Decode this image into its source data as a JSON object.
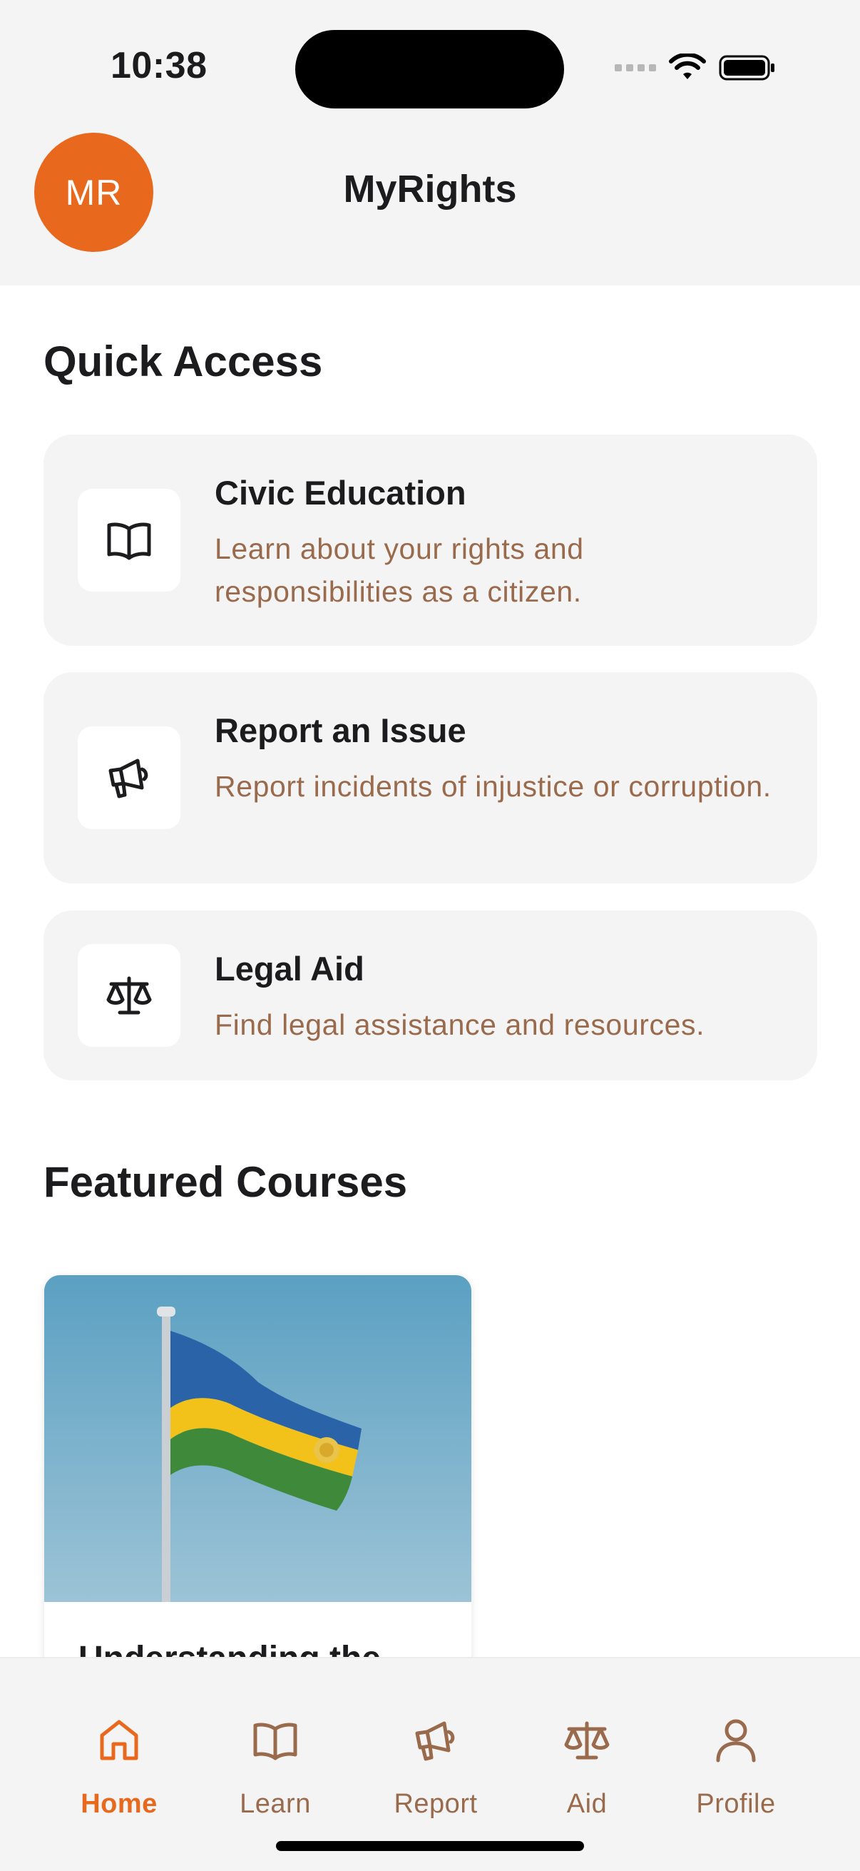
{
  "status_bar": {
    "time": "10:38"
  },
  "header": {
    "avatar_initials": "MR",
    "title": "MyRights"
  },
  "quick_access": {
    "heading": "Quick Access",
    "items": [
      {
        "icon": "book-icon",
        "title": "Civic Education",
        "description": "Learn about your rights and responsibilities as a citizen."
      },
      {
        "icon": "megaphone-icon",
        "title": "Report an Issue",
        "description": "Report incidents of injustice or corruption."
      },
      {
        "icon": "scale-icon",
        "title": "Legal Aid",
        "description": "Find legal assistance and resources."
      }
    ]
  },
  "featured_courses": {
    "heading": "Featured Courses",
    "courses": [
      {
        "title": "Understanding the",
        "image": "rwanda-flag-image"
      }
    ]
  },
  "tab_bar": {
    "active": "Home",
    "tabs": [
      {
        "label": "Home",
        "icon": "home-icon"
      },
      {
        "label": "Learn",
        "icon": "book-icon"
      },
      {
        "label": "Report",
        "icon": "megaphone-icon"
      },
      {
        "label": "Aid",
        "icon": "scale-icon"
      },
      {
        "label": "Profile",
        "icon": "person-icon"
      }
    ]
  },
  "colors": {
    "accent": "#e8681d",
    "secondary_text": "#9a6a4d",
    "surface": "#f4f4f4",
    "text": "#1c1c1e"
  }
}
